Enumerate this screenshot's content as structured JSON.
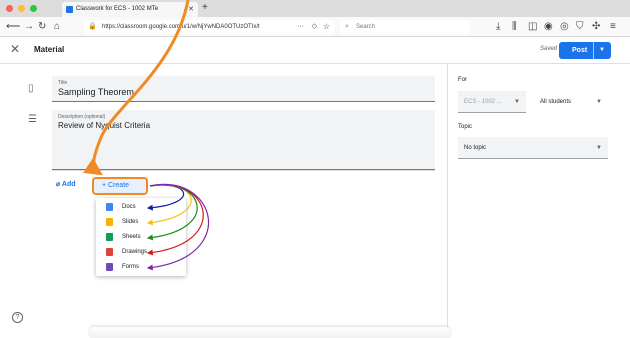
{
  "browser": {
    "tab_title": "Classwork for ECS - 1002 MTe",
    "new_tab": "+",
    "url": "https://classroom.google.com/u/1/w/NjYwNDA0OTUzOTIx/t",
    "search_placeholder": "Search",
    "url_more": "···",
    "close_glyph": "✕"
  },
  "header": {
    "close": "✕",
    "title": "Material",
    "status": "Saved",
    "post_label": "Post"
  },
  "form": {
    "title_label": "Title",
    "title_value": "Sampling Theorem",
    "desc_label": "Description (optional)",
    "desc_value": "Review of Nyquist Criteria",
    "add_label": "Add",
    "create_label": "+ Create"
  },
  "create_menu": {
    "items": [
      {
        "label": "Docs",
        "color": "#4285f4"
      },
      {
        "label": "Slides",
        "color": "#f4b400"
      },
      {
        "label": "Sheets",
        "color": "#0f9d58"
      },
      {
        "label": "Drawings",
        "color": "#db4437"
      },
      {
        "label": "Forms",
        "color": "#7248b9"
      }
    ]
  },
  "sidebar": {
    "for_label": "For",
    "class_value": "ECS - 1002 ...",
    "students_value": "All students",
    "topic_label": "Topic",
    "topic_value": "No topic"
  },
  "annotations": {
    "highlight_color": "#f08a24",
    "arrow_colors": [
      "#1a1aa8",
      "#f4c20d",
      "#1e8c1e",
      "#d41a1a",
      "#7a2aa8"
    ]
  }
}
